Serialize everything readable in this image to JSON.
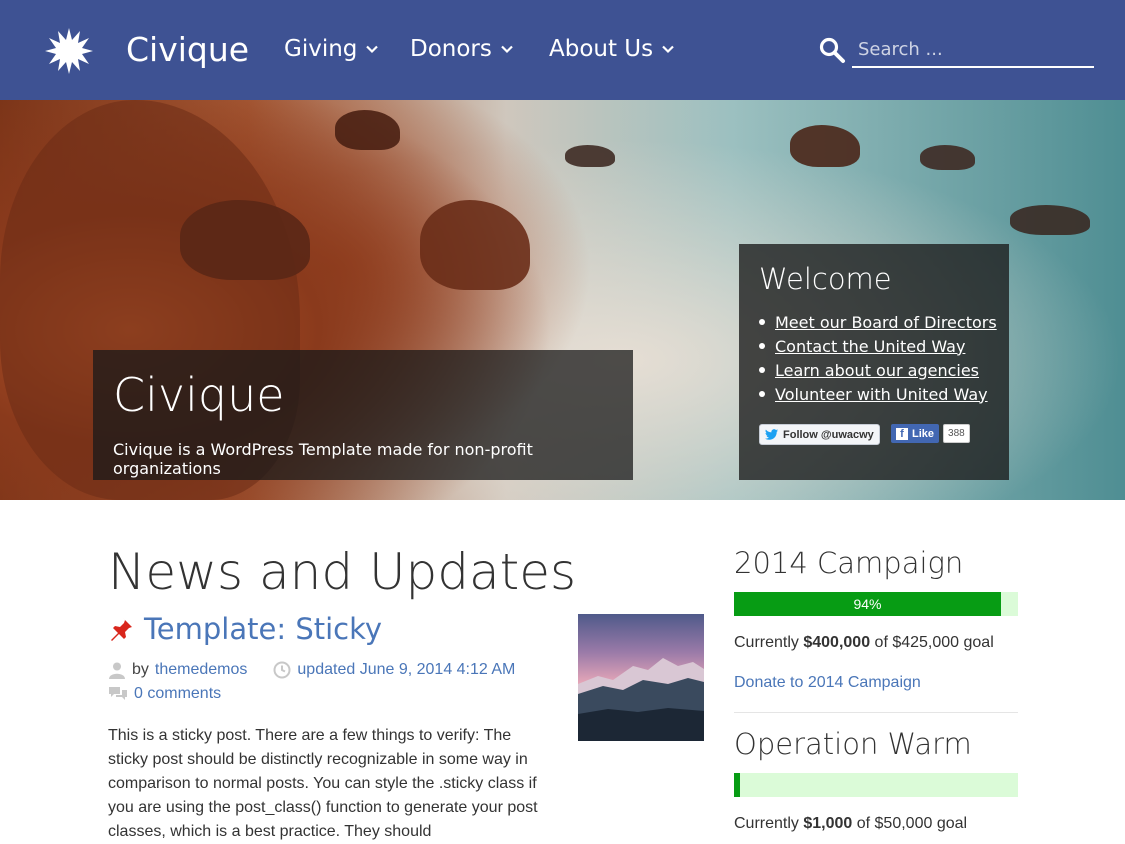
{
  "header": {
    "site_title": "Civique",
    "nav": [
      {
        "label": "Giving"
      },
      {
        "label": "Donors"
      },
      {
        "label": "About Us"
      }
    ],
    "search": {
      "placeholder": "Search ..."
    }
  },
  "hero": {
    "title": "Civique",
    "subtitle": "Civique is a WordPress Template made for non-profit organizations",
    "welcome": {
      "title": "Welcome",
      "links": [
        "Meet our Board of Directors",
        "Contact the United Way",
        "Learn about our agencies",
        "Volunteer with United Way"
      ],
      "twitter_label": "Follow @uwacwy",
      "fb_label": "Like",
      "fb_count": "388"
    }
  },
  "main": {
    "heading": "News and Updates",
    "post": {
      "title": "Template: Sticky",
      "by": "by",
      "author": "themedemos",
      "updated": "updated June 9, 2014 4:12 AM",
      "comments": "0 comments",
      "excerpt": "This is a sticky post. There are a few things to verify: The sticky post should be distinctly recognizable in some way in comparison to normal posts. You can style the .sticky class if you are using the post_class() function to generate your post classes, which is a best practice. They should"
    }
  },
  "sidebar": {
    "campaigns": [
      {
        "title": "2014 Campaign",
        "progress": 0.94,
        "progress_label": "94%",
        "current_prefix": "Currently ",
        "current_amount": "$400,000",
        "goal_text": " of $425,000 goal",
        "donate_link": "Donate to 2014 Campaign"
      },
      {
        "title": "Operation Warm",
        "progress": 0.02,
        "progress_label": "",
        "current_prefix": "Currently ",
        "current_amount": "$1,000",
        "goal_text": " of $50,000 goal"
      }
    ]
  },
  "colors": {
    "header_bg": "#3e5293",
    "link": "#4a76b8",
    "progress_fill": "#079c14",
    "progress_track": "#dbfbd8"
  }
}
